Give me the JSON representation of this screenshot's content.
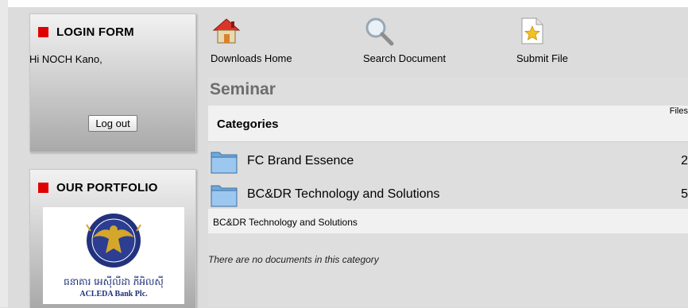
{
  "sidebar": {
    "login": {
      "title": "LOGIN FORM",
      "greeting": "Hi NOCH Kano,",
      "logout_label": "Log out"
    },
    "portfolio": {
      "title": "OUR PORTFOLIO",
      "logo_khmer": "ធនាគារ អេស៊ីលីដា ភីអិលស៊ី",
      "logo_english": "ACLEDA Bank Plc."
    }
  },
  "toolbar": {
    "downloads_home": "Downloads Home",
    "search_document": "Search Document",
    "submit_file": "Submit File"
  },
  "main": {
    "section_title": "Seminar",
    "categories_header": "Categories",
    "files_header": "Files",
    "categories": [
      {
        "name": "FC Brand Essence",
        "count": "2"
      },
      {
        "name": "BC&DR Technology and Solutions",
        "count": "5"
      }
    ],
    "subcategory_label": "BC&DR Technology and Solutions",
    "empty_message": "There are no documents in this category"
  },
  "colors": {
    "accent_red": "#e00000",
    "section_title_gray": "#6d6d6d",
    "logo_blue": "#1e2f79"
  },
  "icons": [
    "home-icon",
    "search-icon",
    "submit-file-icon",
    "folder-icon"
  ]
}
